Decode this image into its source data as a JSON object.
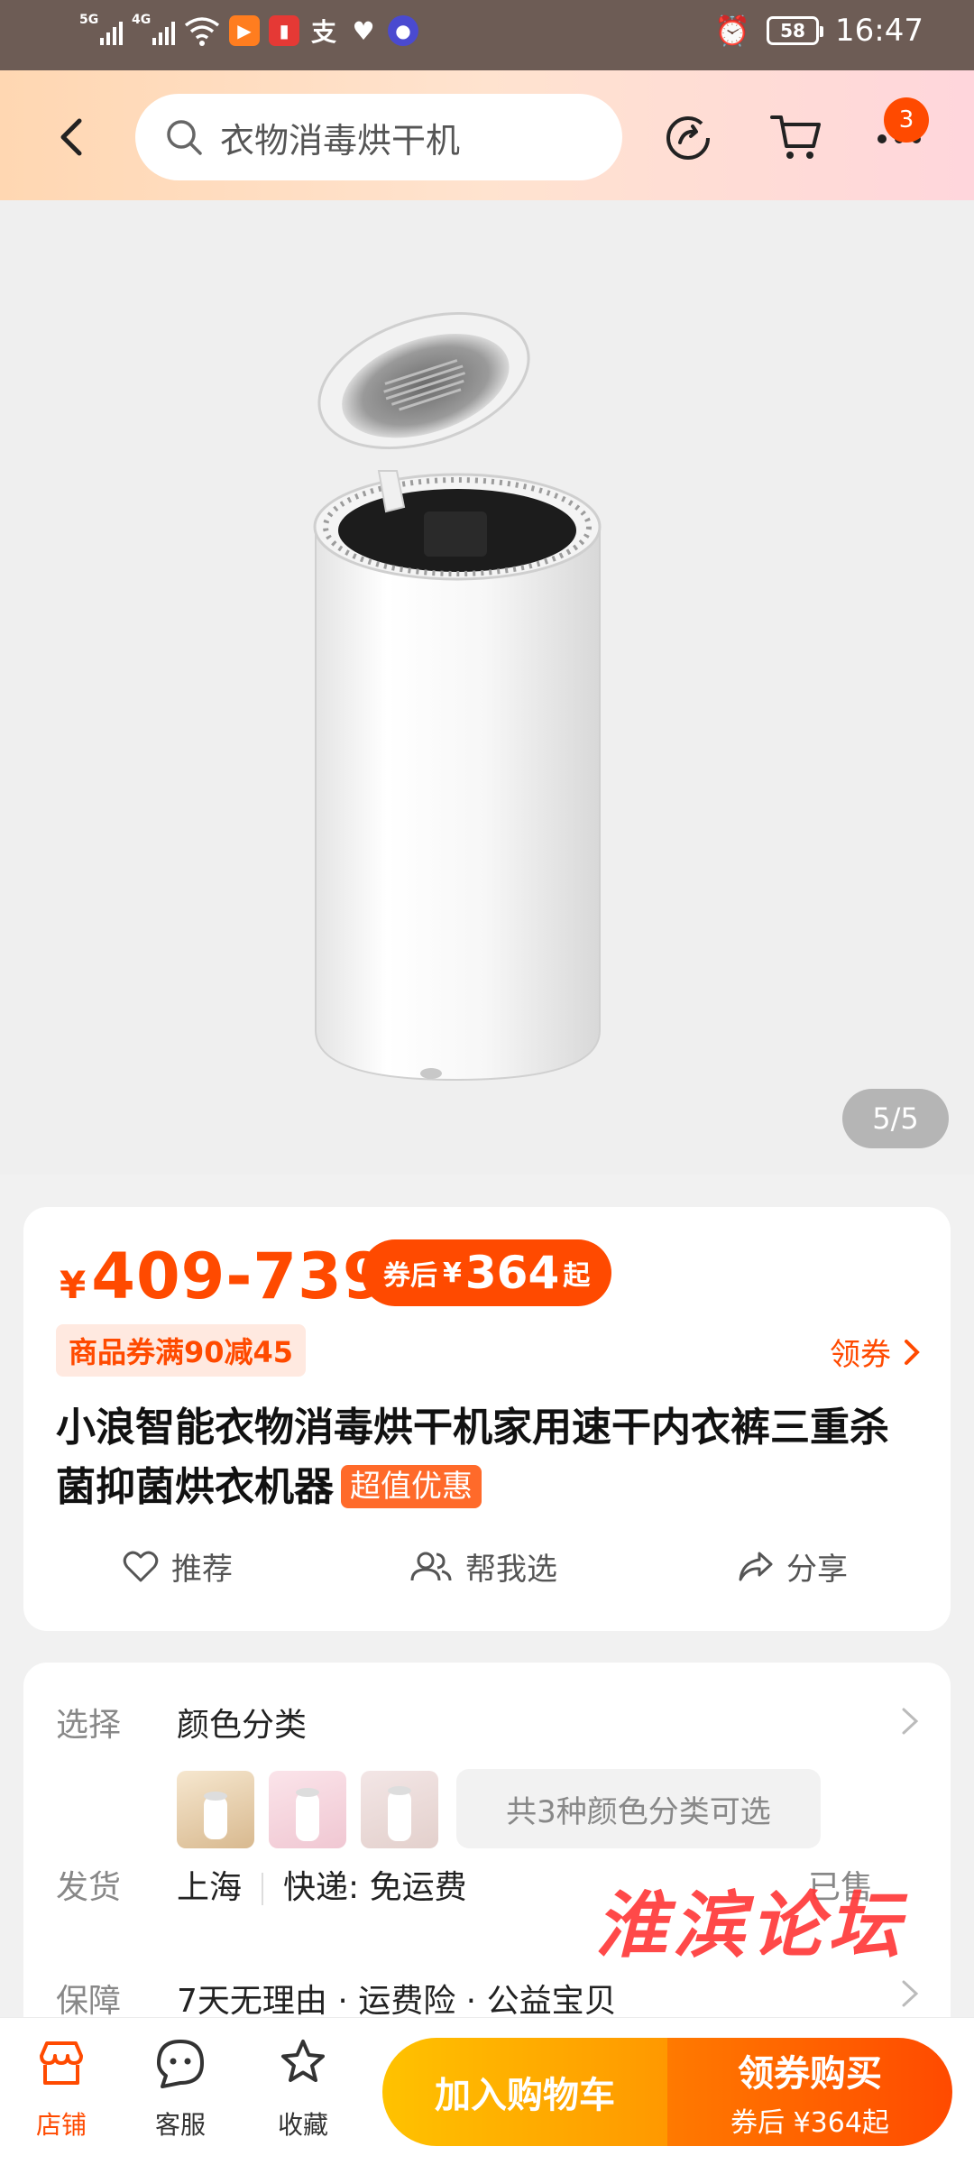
{
  "status_bar": {
    "time": "16:47",
    "battery": "58",
    "signal1": "5G",
    "signal2": "4G"
  },
  "header": {
    "search_query": "衣物消毒烘干机",
    "cart_badge": "3"
  },
  "gallery": {
    "pager": "5/5"
  },
  "price": {
    "currency": "¥",
    "range": "409-739",
    "coupon_prefix": "券后",
    "coupon_currency": "¥",
    "coupon_price": "364",
    "coupon_suffix": "起",
    "promo": "商品券满90减45",
    "get_coupon": "领券"
  },
  "product": {
    "title": "小浪智能衣物消毒烘干机家用速干内衣裤三重杀菌抑菌烘衣机器",
    "tag": "超值优惠"
  },
  "actions": {
    "recommend": "推荐",
    "help_choose": "帮我选",
    "share": "分享"
  },
  "options": {
    "select_label": "选择",
    "select_value": "颜色分类",
    "color_note": "共3种颜色分类可选",
    "ship_label": "发货",
    "ship_from": "上海",
    "ship_method": "快递: 免运费",
    "ship_extra": "已售",
    "guarantee_label": "保障",
    "guarantee_value": "7天无理由 · 运费险 · 公益宝贝"
  },
  "watermark": "淮滨论坛",
  "bottom_bar": {
    "store": "店铺",
    "service": "客服",
    "favorite": "收藏",
    "add_cart": "加入购物车",
    "buy_title": "领券购买",
    "buy_sub": "券后 ¥364起"
  },
  "colors": {
    "accent": "#ff4a00",
    "cart_gradient_start": "#ffc200",
    "buy_gradient_end": "#ff4a00"
  }
}
